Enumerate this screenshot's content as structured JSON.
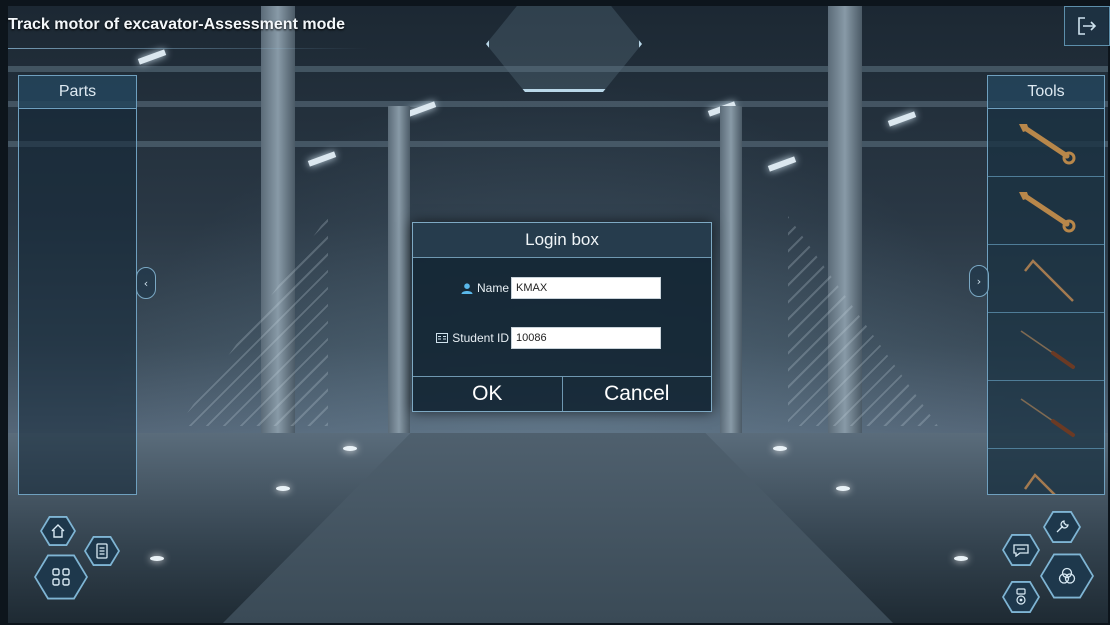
{
  "header": {
    "title": "Track motor of excavator-Assessment mode",
    "exit_icon": "exit-icon"
  },
  "parts_panel": {
    "title": "Parts"
  },
  "tools_panel": {
    "title": "Tools",
    "items": [
      {
        "icon": "wrench-icon"
      },
      {
        "icon": "wrench-icon"
      },
      {
        "icon": "hex-key-icon"
      },
      {
        "icon": "screwdriver-icon"
      },
      {
        "icon": "screwdriver-icon"
      },
      {
        "icon": "hex-key-icon"
      }
    ]
  },
  "login_dialog": {
    "title": "Login box",
    "name_label": "Name",
    "name_value": "KMAX",
    "student_id_label": "Student ID",
    "student_id_value": "10086",
    "ok_label": "OK",
    "cancel_label": "Cancel"
  },
  "bottom_left_buttons": [
    {
      "icon": "home-icon"
    },
    {
      "icon": "grid-menu-icon"
    },
    {
      "icon": "document-icon"
    }
  ],
  "bottom_right_buttons": [
    {
      "icon": "wrench-icon"
    },
    {
      "icon": "chat-icon"
    },
    {
      "icon": "assembly-icon"
    },
    {
      "icon": "pulley-icon"
    }
  ],
  "colors": {
    "accent": "#7fb5d4",
    "panel_border": "#6fa0bf",
    "panel_fill": "#14283a"
  }
}
